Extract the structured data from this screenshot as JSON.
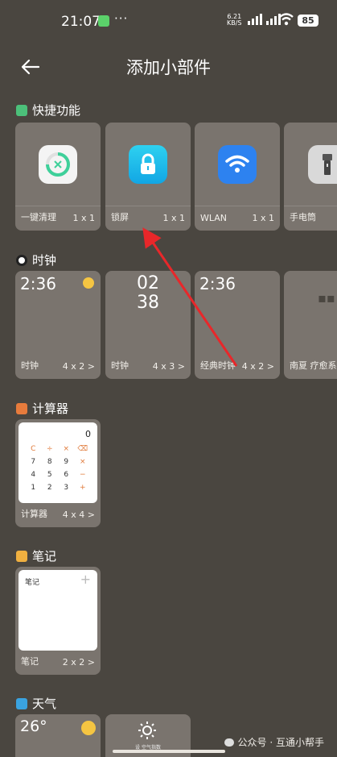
{
  "status": {
    "time": "21:07",
    "speed_top": "6.21",
    "speed_bottom": "KB/S",
    "battery": "85",
    "more": "···"
  },
  "header": {
    "title": "添加小部件"
  },
  "sections": {
    "quick": {
      "title": "快捷功能",
      "color": "#4cc07a"
    },
    "clock": {
      "title": "时钟"
    },
    "calc": {
      "title": "计算器",
      "color": "#e77b3c"
    },
    "notes": {
      "title": "笔记",
      "color": "#f0b040"
    },
    "weather": {
      "title": "天气",
      "color": "#3aa3e0"
    }
  },
  "quick_cards": [
    {
      "label": "一键清理",
      "size": "1 x 1",
      "icon": "clean-icon"
    },
    {
      "label": "锁屏",
      "size": "1 x 1",
      "icon": "lock-icon"
    },
    {
      "label": "WLAN",
      "size": "1 x 1",
      "icon": "wifi-icon"
    },
    {
      "label": "手电筒",
      "size": "",
      "icon": "flashlight-icon"
    }
  ],
  "clock_cards": [
    {
      "label": "时钟",
      "size": "4 x 2 >",
      "time": "2:36"
    },
    {
      "label": "时钟",
      "size": "4 x 3 >",
      "hour": "02",
      "minute": "38"
    },
    {
      "label": "经典时钟",
      "size": "4 x 2 >",
      "time": "2:36"
    },
    {
      "label": "南夏 疗愈系列",
      "size": ""
    }
  ],
  "calc_card": {
    "label": "计算器",
    "size": "4 x 4 >",
    "display": "0",
    "keys": [
      "C",
      "÷",
      "×",
      "⌫",
      "7",
      "8",
      "9",
      "×",
      "4",
      "5",
      "6",
      "−",
      "1",
      "2",
      "3",
      "+"
    ]
  },
  "notes_card": {
    "label": "笔记",
    "size": "2 x 2 >",
    "inner_title": "笔记",
    "plus": "+"
  },
  "weather_cards": [
    {
      "temp": "26°"
    },
    {
      "label": "设 空气指数"
    }
  ],
  "watermark": "公众号 · 互通小帮手"
}
